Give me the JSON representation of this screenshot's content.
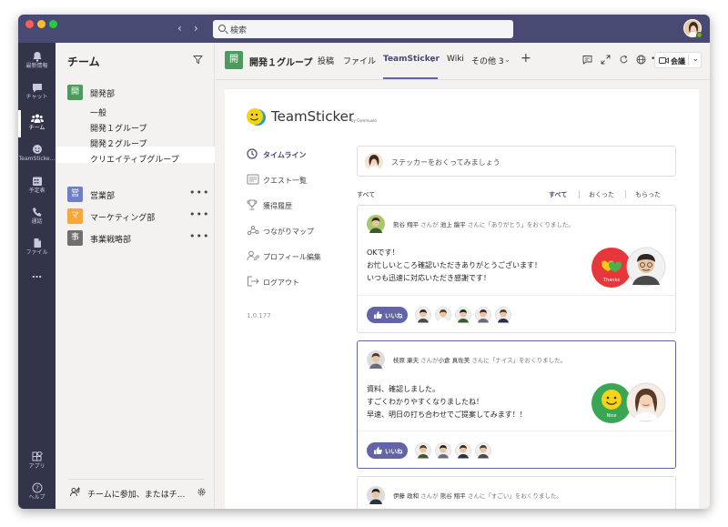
{
  "search": {
    "placeholder": "検索"
  },
  "rail": {
    "items": [
      {
        "label": "最新情報",
        "icon": "bell-icon"
      },
      {
        "label": "チャット",
        "icon": "chat-icon"
      },
      {
        "label": "チーム",
        "icon": "teams-icon",
        "active": true
      },
      {
        "label": "TeamSticke...",
        "icon": "sticker-icon"
      },
      {
        "label": "予定表",
        "icon": "calendar-icon"
      },
      {
        "label": "通話",
        "icon": "phone-icon"
      },
      {
        "label": "ファイル",
        "icon": "file-icon"
      },
      {
        "label": "…",
        "icon": "more-icon"
      }
    ],
    "bottom": [
      {
        "label": "アプリ",
        "icon": "apps-icon"
      },
      {
        "label": "ヘルプ",
        "icon": "help-icon"
      }
    ]
  },
  "teams_panel": {
    "title": "チーム",
    "teams": [
      {
        "tile": "開",
        "name": "開発部",
        "color": "#4d9a5e"
      },
      {
        "tile": "営",
        "name": "営業部",
        "color": "#6f7fc6"
      },
      {
        "tile": "マ",
        "name": "マーケティング部",
        "color": "#f5a83c"
      },
      {
        "tile": "事",
        "name": "事業戦略部",
        "color": "#6f6f6f"
      }
    ],
    "channels": [
      "一般",
      "開発１グループ",
      "開発２グループ",
      "クリエイティブグループ"
    ],
    "selected_channel": "開発１グループ",
    "more": "•••",
    "join": "チームに参加、またはチ..."
  },
  "header": {
    "tile": "開",
    "channel": "開発１グループ",
    "tabs": [
      "投稿",
      "ファイル",
      "TeamSticker",
      "Wiki",
      "その他 3"
    ],
    "active_tab": "TeamSticker",
    "more": "•••",
    "meet": "会議"
  },
  "sticker": {
    "brand": "TeamSticker",
    "brand_sub": "by Communio",
    "menu": [
      {
        "label": "タイムライン",
        "icon": "timeline-icon",
        "active": true
      },
      {
        "label": "クエスト一覧",
        "icon": "quest-icon"
      },
      {
        "label": "獲得履歴",
        "icon": "trophy-icon"
      },
      {
        "label": "つながりマップ",
        "icon": "network-icon"
      },
      {
        "label": "プロフィール編集",
        "icon": "profile-edit-icon"
      },
      {
        "label": "ログアウト",
        "icon": "logout-icon"
      }
    ],
    "version": "1.0.177",
    "compose_placeholder": "ステッカーをおくってみましょう",
    "filter_label": "すべて",
    "filters": [
      "すべて",
      "おくった",
      "もらった"
    ],
    "like_label": "いいね",
    "posts": [
      {
        "from": "熊谷 翔平",
        "san1": "さんが",
        "to": "池上 龍平",
        "tail": "さんに「ありがとう」をおくりました。",
        "lines": [
          "OKです！",
          "お忙しいところ確認いただきありがとうございます！",
          "いつも迅速に対応いただき感謝です！"
        ],
        "sticker": "Thanks",
        "sticker_color": "#e8373b",
        "likes": 5
      },
      {
        "from": "枝原 康夫",
        "san1": "さんが",
        "to": "小倉 真佐美",
        "tail": "さんに「ナイス」をおくりました。",
        "lines": [
          "資料、確認しました。",
          "すごくわかりやすくなりましたね！",
          "早速、明日の打ち合わせでご提案してみます！！"
        ],
        "sticker": "Nice",
        "sticker_color": "#3aa655",
        "likes": 4
      },
      {
        "from": "伊藤 政和",
        "san1": "さんが",
        "to": "熊谷 翔平",
        "tail": "さんに「すごい」をおくりました。"
      }
    ]
  }
}
